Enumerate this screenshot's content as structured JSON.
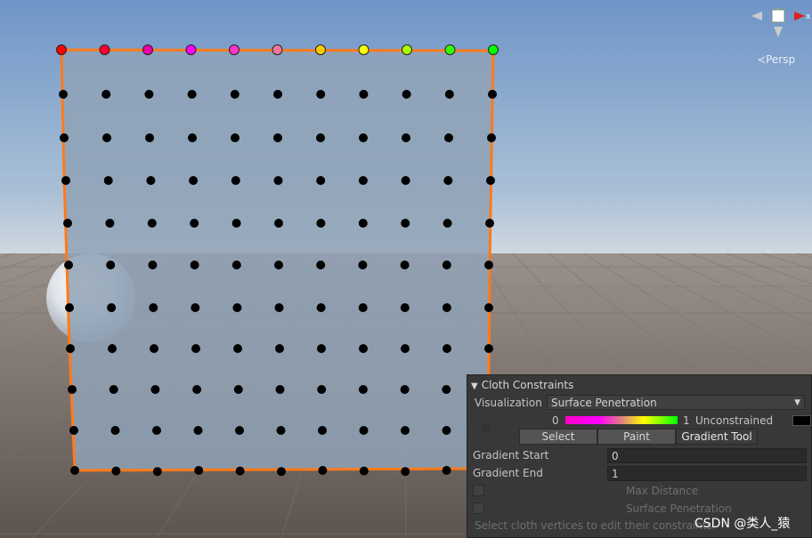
{
  "colors": {
    "sky_top": "#6f96c8",
    "sky_horizon": "#c9d6e2",
    "ground_near": "#6f625a",
    "ground_far": "#8e847e",
    "cloth": "#8fa2b6",
    "cloth_edge": "#ff7a1a",
    "vertex": "#000000",
    "panel_bg": "#383838"
  },
  "scene": {
    "view_label": "Persp",
    "gizmo_axis_label": "x",
    "top_row_colors": [
      "#ff0000",
      "#ff0033",
      "#ee00aa",
      "#ff00ff",
      "#ff33cc",
      "#ee7799",
      "#ffcc00",
      "#ffff00",
      "#aaff00",
      "#33ff00",
      "#00ff00"
    ]
  },
  "panel": {
    "title": "Cloth Constraints",
    "visualization_label": "Visualization",
    "visualization_value": "Surface Penetration",
    "gradient_min": "0",
    "gradient_max": "1",
    "unconstrained_label": "Unconstrained",
    "tools": [
      {
        "label": "Select",
        "active": false
      },
      {
        "label": "Paint",
        "active": false
      },
      {
        "label": "Gradient Tool",
        "active": true
      }
    ],
    "gradient_start_label": "Gradient Start",
    "gradient_start_value": "0",
    "gradient_end_label": "Gradient End",
    "gradient_end_value": "1",
    "max_distance_label": "Max Distance",
    "surface_penetration_label": "Surface Penetration",
    "hint": "Select cloth vertices to edit their constraints."
  },
  "watermark": "CSDN @类人_猿"
}
